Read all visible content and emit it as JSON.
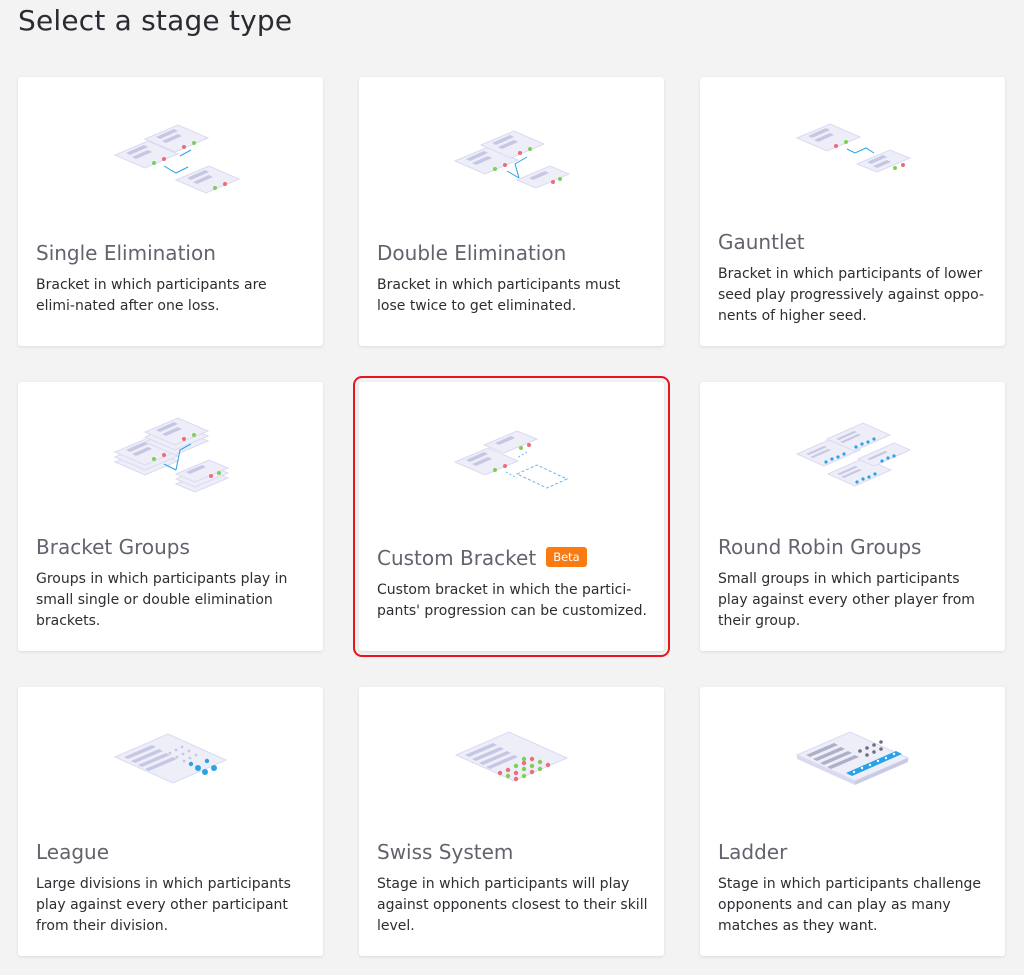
{
  "page": {
    "title": "Select a stage type"
  },
  "colors": {
    "selected_outline": "#e8141e",
    "badge": "#f97b12",
    "accent": "#2aa2e8"
  },
  "cards": [
    {
      "title": "Single Elimination",
      "description": "Bracket in which participants are elimi-nated after one loss.",
      "icon": "single-elimination-bracket-illustration"
    },
    {
      "title": "Double Elimination",
      "description": "Bracket in which participants must lose twice to get eliminated.",
      "icon": "double-elimination-bracket-illustration"
    },
    {
      "title": "Gauntlet",
      "description": "Bracket in which participants of lower seed play progressively against oppo-nents of higher seed.",
      "icon": "gauntlet-bracket-illustration"
    },
    {
      "title": "Bracket Groups",
      "description": "Groups in which participants play in small single or double elimination brackets.",
      "icon": "bracket-groups-illustration"
    },
    {
      "title": "Custom Bracket",
      "badge": "Beta",
      "description": "Custom bracket in which the partici-pants' progression can be customized.",
      "icon": "custom-bracket-illustration",
      "selected": true
    },
    {
      "title": "Round Robin Groups",
      "description": "Small groups in which participants play against every other player from their group.",
      "icon": "round-robin-groups-illustration"
    },
    {
      "title": "League",
      "description": "Large divisions in which participants play against every other participant from their division.",
      "icon": "league-table-illustration"
    },
    {
      "title": "Swiss System",
      "description": "Stage in which participants will play against opponents closest to their skill level.",
      "icon": "swiss-system-grid-illustration"
    },
    {
      "title": "Ladder",
      "description": "Stage in which participants challenge opponents and can play as many matches as they want.",
      "icon": "ladder-ranking-illustration"
    }
  ]
}
